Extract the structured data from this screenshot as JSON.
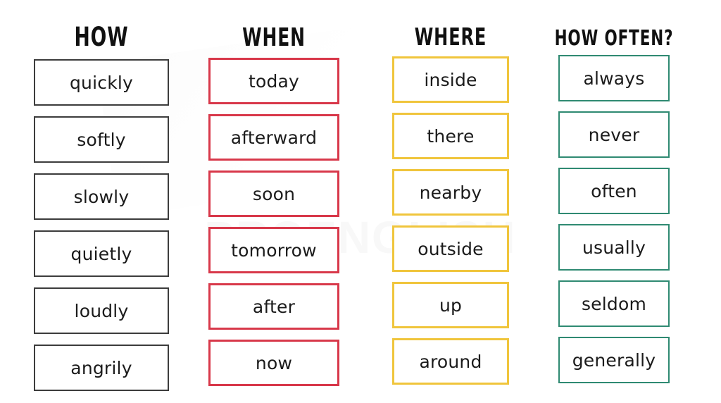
{
  "page": {
    "background_color": "#ffffff",
    "watermark_text": "PROENGLISH"
  },
  "columns": [
    {
      "id": "how",
      "header": "HOW",
      "border_color": "#3c3c3c",
      "words": [
        "quickly",
        "softly",
        "slowly",
        "quietly",
        "loudly",
        "angrily"
      ]
    },
    {
      "id": "when",
      "header": "WHEN",
      "border_color": "#d8384a",
      "words": [
        "today",
        "afterward",
        "soon",
        "tomorrow",
        "after",
        "now"
      ]
    },
    {
      "id": "where",
      "header": "WHERE",
      "border_color": "#f0c53c",
      "words": [
        "inside",
        "there",
        "nearby",
        "outside",
        "up",
        "around"
      ]
    },
    {
      "id": "how-often",
      "header": "HOW OFTEN?",
      "border_color": "#2f8a72",
      "words": [
        "always",
        "never",
        "often",
        "usually",
        "seldom",
        "generally"
      ]
    }
  ]
}
